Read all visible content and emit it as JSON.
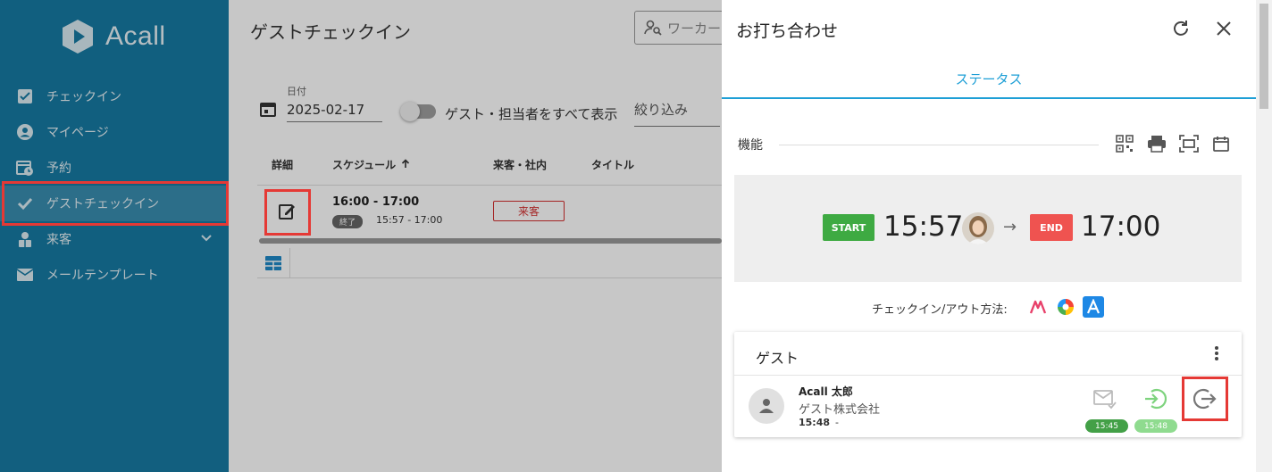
{
  "sidebar": {
    "logo_text": "Acall",
    "items": [
      {
        "label": "チェックイン",
        "icon": "checkbox-icon"
      },
      {
        "label": "マイページ",
        "icon": "account-icon"
      },
      {
        "label": "予約",
        "icon": "calendar-clock-icon"
      },
      {
        "label": "ゲストチェックイン",
        "icon": "check-icon",
        "active": true
      },
      {
        "label": "来客",
        "icon": "visitor-icon"
      },
      {
        "label": "メールテンプレート",
        "icon": "mail-icon"
      }
    ]
  },
  "main": {
    "title": "ゲストチェックイン",
    "search_placeholder": "ワーカー",
    "date_label": "日付",
    "date_value": "2025-02-17",
    "toggle_label": "ゲスト・担当者をすべて表示",
    "filter_placeholder": "絞り込み",
    "columns": {
      "detail": "詳細",
      "schedule": "スケジュール",
      "visit": "来客・社内",
      "title": "タイトル"
    },
    "row": {
      "time": "16:00 - 17:00",
      "status_badge": "終了",
      "actual_time": "15:57 - 17:00",
      "visit_badge": "来客"
    }
  },
  "panel": {
    "title": "お打ち合わせ",
    "tab": "ステータス",
    "function_label": "機能",
    "start_label": "START",
    "start_time": "15:57",
    "end_label": "END",
    "end_time": "17:00",
    "method_label": "チェックイン/アウト方法:",
    "guest_section": "ゲスト",
    "guest": {
      "name": "Acall 太郎",
      "company": "ゲスト株式会社",
      "time": "15:48",
      "time_suffix": "-",
      "mail_time": "15:45",
      "checkin_time": "15:48"
    }
  },
  "colors": {
    "sidebar": "#177aa3",
    "accent": "#1e9fd6",
    "start": "#3eaa42",
    "end": "#ef5350",
    "highlight": "#e53935"
  }
}
